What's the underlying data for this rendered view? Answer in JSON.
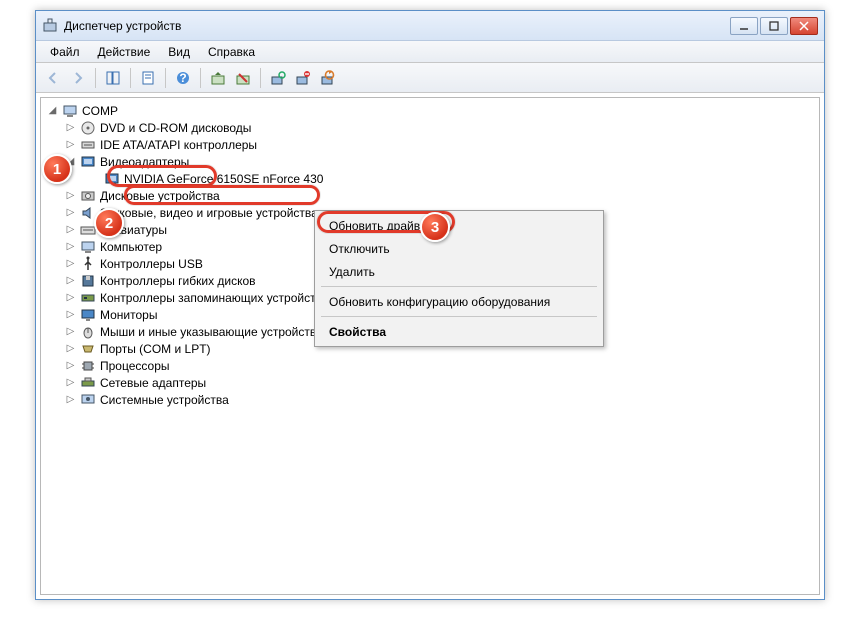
{
  "window": {
    "title": "Диспетчер устройств"
  },
  "menu": {
    "file": "Файл",
    "action": "Действие",
    "view": "Вид",
    "help": "Справка"
  },
  "tree": {
    "root": "COMP",
    "items": [
      {
        "label": "DVD и CD-ROM дисководы"
      },
      {
        "label": "IDE ATA/ATAPI контроллеры"
      },
      {
        "label": "Видеоадаптеры",
        "children": [
          {
            "label": "NVIDIA GeForce 6150SE nForce 430"
          }
        ]
      },
      {
        "label": "Дисковые устройства"
      },
      {
        "label": "Звуковые, видео и игровые устройства"
      },
      {
        "label": "Клавиатуры"
      },
      {
        "label": "Компьютер"
      },
      {
        "label": "Контроллеры USB"
      },
      {
        "label": "Контроллеры гибких дисков"
      },
      {
        "label": "Контроллеры запоминающих устройств"
      },
      {
        "label": "Мониторы"
      },
      {
        "label": "Мыши и иные указывающие устройства"
      },
      {
        "label": "Порты (COM и LPT)"
      },
      {
        "label": "Процессоры"
      },
      {
        "label": "Сетевые адаптеры"
      },
      {
        "label": "Системные устройства"
      }
    ]
  },
  "context": {
    "update": "Обновить драйверы...",
    "disable": "Отключить",
    "delete": "Удалить",
    "scan": "Обновить конфигурацию оборудования",
    "props": "Свойства"
  },
  "markers": {
    "one": "1",
    "two": "2",
    "three": "3"
  }
}
